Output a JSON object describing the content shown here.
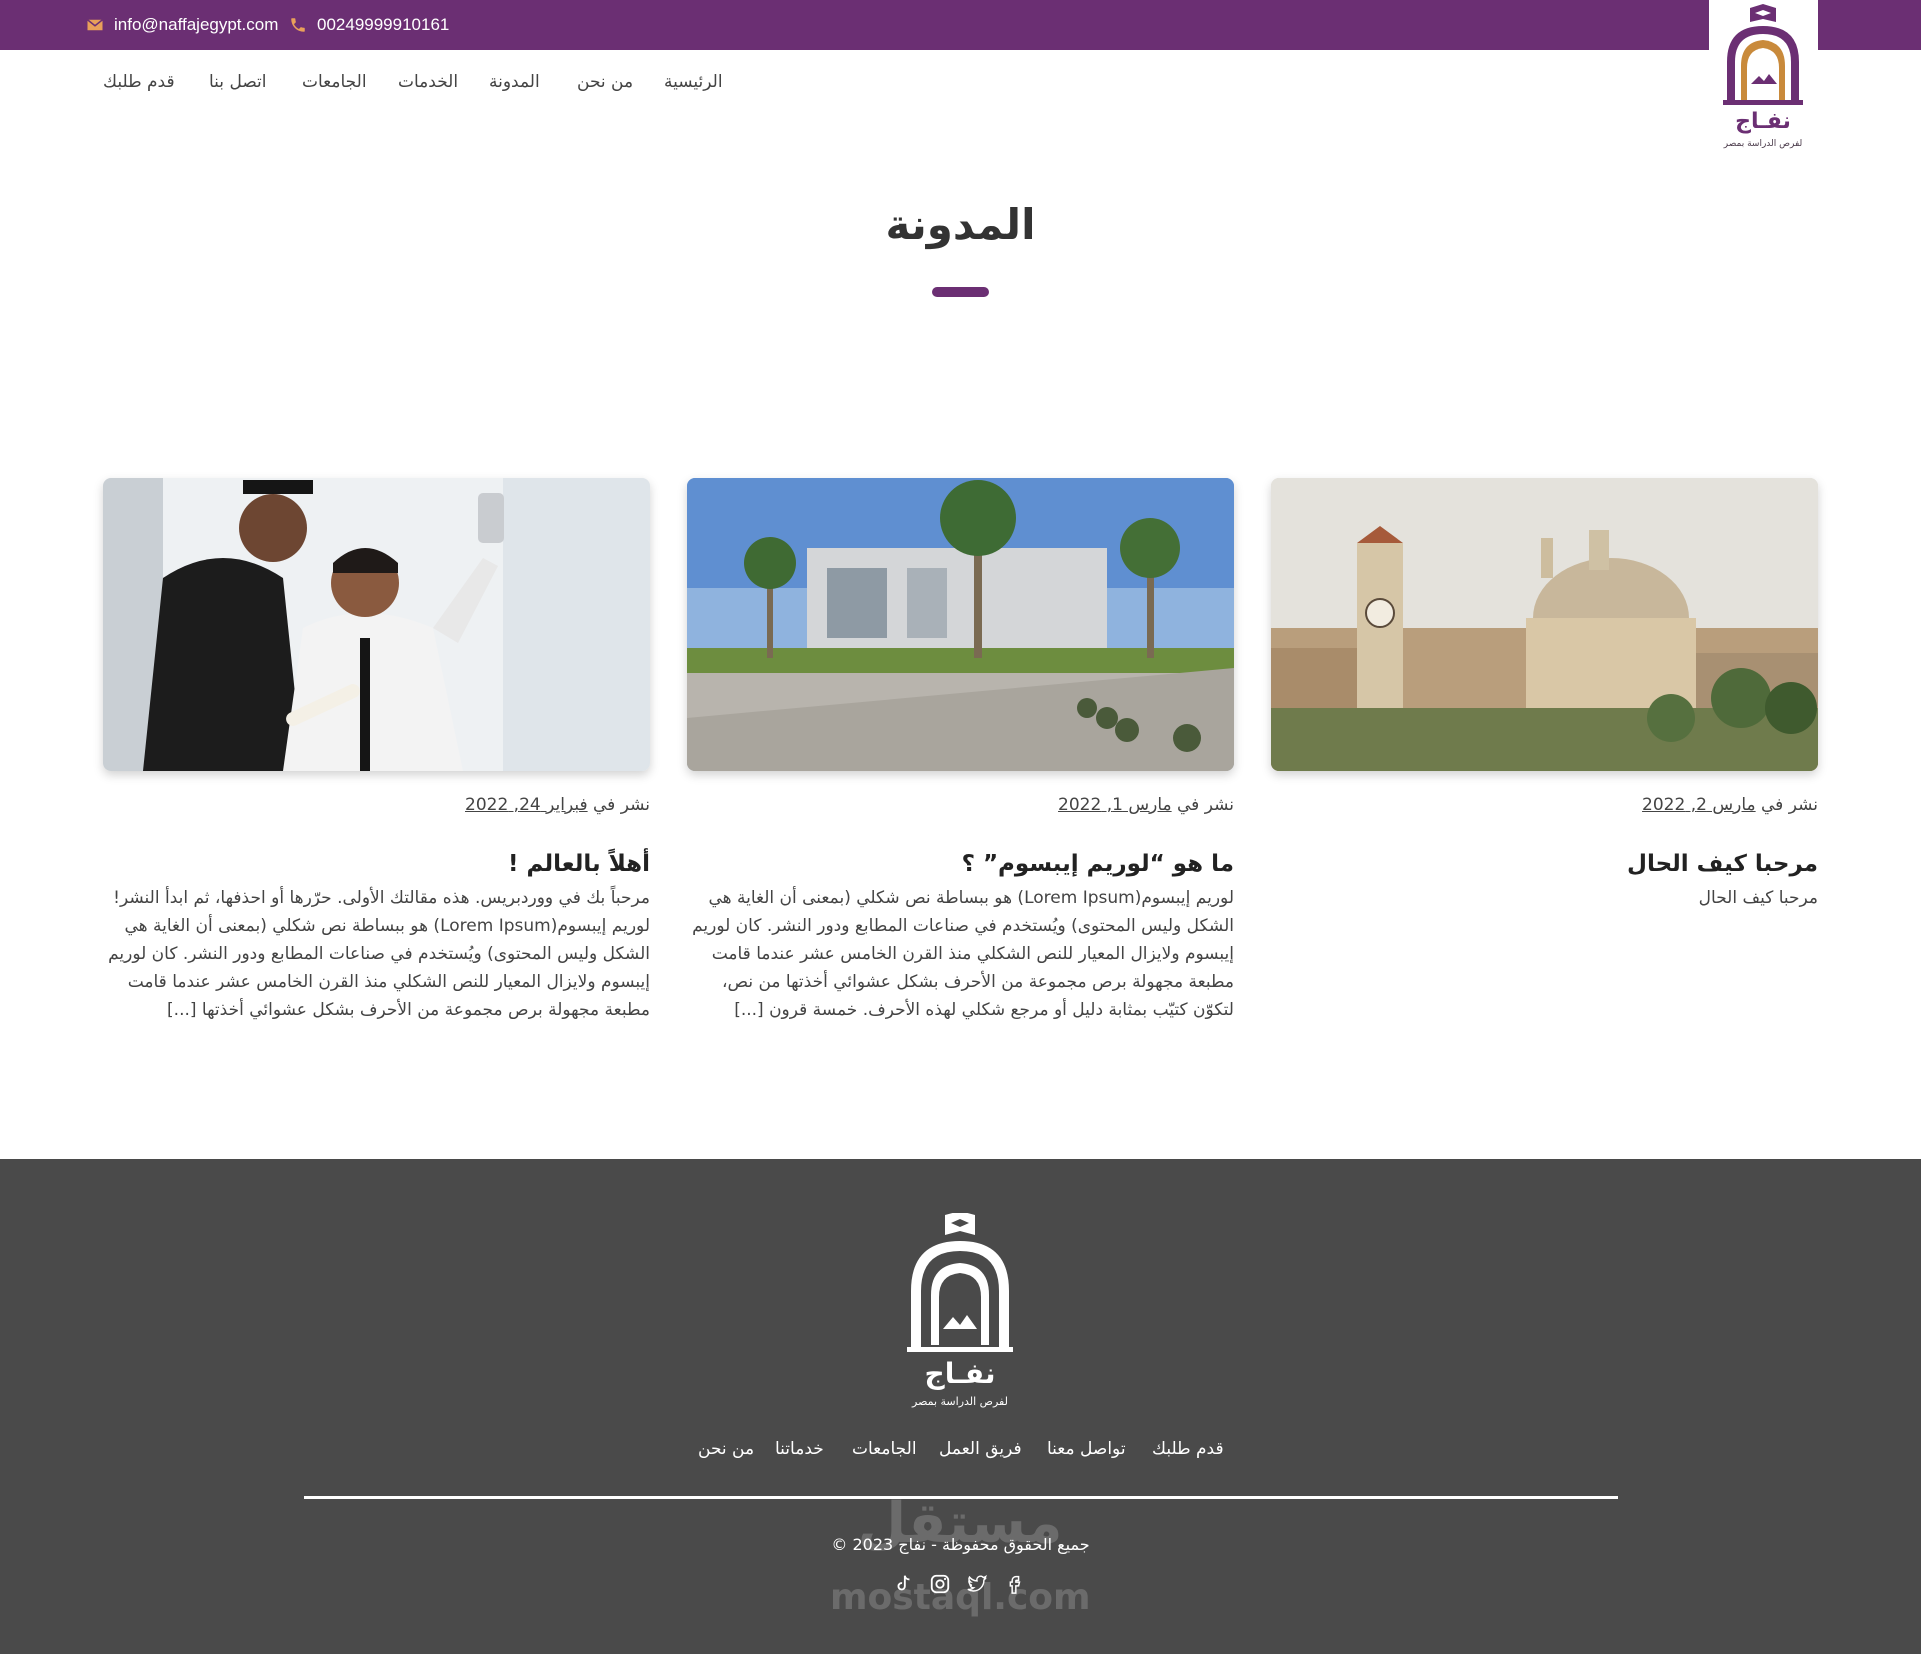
{
  "topbar": {
    "email": "info@naffajegypt.com",
    "phone": "00249999910161",
    "background_color": "#6b2f73"
  },
  "logo": {
    "name": "نفـاج",
    "tagline": "لفرص الدراسة بمصر"
  },
  "nav": {
    "items": [
      {
        "label": "الرئيسية"
      },
      {
        "label": "من نحن"
      },
      {
        "label": "المدونة"
      },
      {
        "label": "الخدمات"
      },
      {
        "label": "الجامعات"
      },
      {
        "label": "اتصل بنا"
      },
      {
        "label": "قدم طلبك"
      }
    ]
  },
  "page": {
    "title": "المدونة",
    "accent_color": "#6b2f73"
  },
  "posts": [
    {
      "image": "cairo-university-dome",
      "meta_prefix": "نشر في",
      "date": "مارس 2, 2022",
      "title": "مرحبا كيف الحال",
      "excerpt": "مرحبا كيف الحال"
    },
    {
      "image": "modern-campus-with-palm-trees",
      "meta_prefix": "نشر في",
      "date": "مارس 1, 2022",
      "title": "ما هو “لوريم إيبسوم” ؟",
      "excerpt": "لوريم إيبسوم(Lorem Ipsum) هو ببساطة نص شكلي (بمعنى أن الغاية هي الشكل وليس المحتوى) ويُستخدم في صناعات المطابع ودور النشر. كان لوريم إيبسوم ولايزال المعيار للنص الشكلي منذ القرن الخامس عشر عندما قامت مطبعة مجهولة برص مجموعة من الأحرف بشكل عشوائي أخذتها من نص، لتكوّن كتيّب بمثابة دليل أو مرجع شكلي لهذه الأحرف. خمسة قرون [...]"
    },
    {
      "image": "graduates-taking-selfie",
      "meta_prefix": "نشر في",
      "date": "فبراير 24, 2022",
      "title": "أهلاً بالعالم !",
      "excerpt": "مرحباً بك في ووردبريس. هذه مقالتك الأولى. حرّرها أو احذفها، ثم ابدأ النشر! لوريم إيبسوم(Lorem Ipsum) هو ببساطة نص شكلي (بمعنى أن الغاية هي الشكل وليس المحتوى) ويُستخدم في صناعات المطابع ودور النشر. كان لوريم إيبسوم ولايزال المعيار للنص الشكلي منذ القرن الخامس عشر عندما قامت مطبعة مجهولة برص مجموعة من الأحرف بشكل عشوائي أخذتها [...]"
    }
  ],
  "footer": {
    "background_color": "#4a4a4a",
    "links": [
      {
        "label": "قدم طلبك"
      },
      {
        "label": "تواصل معنا"
      },
      {
        "label": "فريق العمل"
      },
      {
        "label": "الجامعات"
      },
      {
        "label": "خدماتنا"
      },
      {
        "label": "من نحن"
      }
    ],
    "copyright": "© 2023 جميع الحقوق محفوظة - نفاج",
    "socials": [
      "facebook-icon",
      "twitter-icon",
      "instagram-icon",
      "tiktok-icon"
    ],
    "watermark_ar": "مستقل",
    "watermark_en": "mostaql.com"
  }
}
